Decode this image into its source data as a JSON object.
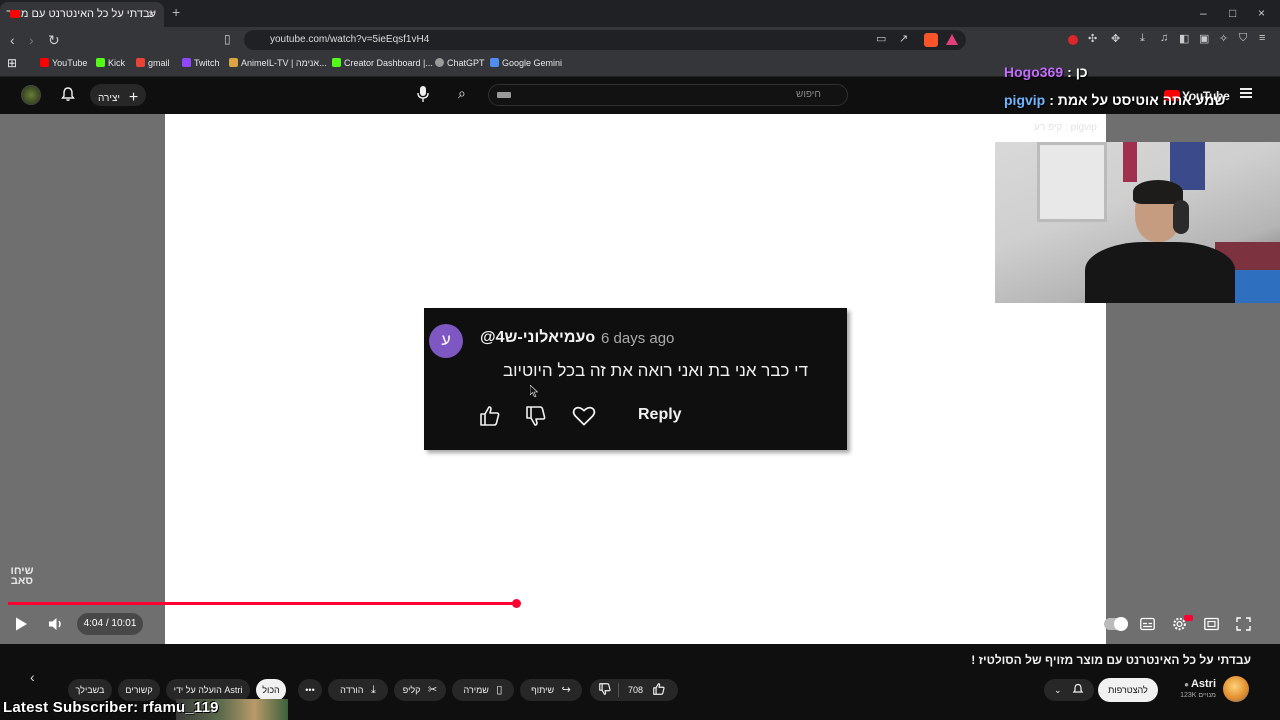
{
  "browser": {
    "tab_title": "עבדתי על כל האינטרנט עם מוצר",
    "tab_close": "×",
    "new_tab": "+",
    "url": "youtube.com/watch?v=5ieEqsf1vH4",
    "window_controls": [
      "–",
      "□",
      "×"
    ],
    "bookmarks": [
      {
        "label": "YouTube",
        "color": "#ff0000"
      },
      {
        "label": "Kick",
        "color": "#53fc18"
      },
      {
        "label": "gmail",
        "color": "#ea4335"
      },
      {
        "label": "Twitch",
        "color": "#9146ff"
      },
      {
        "label": "AnimeIL-TV | אנימה...",
        "color": "#d9a441"
      },
      {
        "label": "Creator Dashboard |...",
        "color": "#53fc18"
      },
      {
        "label": "ChatGPT",
        "color": "#9a9a9a"
      },
      {
        "label": "Google Gemini",
        "color": "#4f8df5"
      }
    ]
  },
  "youtube_header": {
    "search_placeholder": "חיפוש",
    "create_label": "יצירה",
    "logo_text": "YouTube"
  },
  "stream_overlay": {
    "chat1_user": "Hogo369",
    "chat1_msg": ": כן",
    "chat2_user": "pigvip",
    "chat2_msg": ": שמע אתה אוטיסט על אמת",
    "chat3_text": "קיפ רע : pigvip"
  },
  "comment": {
    "avatar_letter": "ע",
    "author": "@עמיאלוני-ש4o",
    "time": "6 days ago",
    "text": "די כבר אני בת ואני רואה את זה בכל היוטיוב",
    "reply_label": "Reply"
  },
  "watermark": "שיחו סאב",
  "player": {
    "time_display": "4:04 / 10:01",
    "progress_fraction": 0.463,
    "buffered_fraction": 0.502
  },
  "video_info": {
    "title": "עבדתי על כל האינטרנט עם מוצר מזויף של הסולטיז !",
    "channel_name": "Astri",
    "channel_subs": "123K מנויים",
    "subscribe_label": "להצטרפות",
    "like_count": "708",
    "share_label": "שיתוף",
    "save_label": "שמירה",
    "clip_label": "קליפ",
    "download_label": "הורדה",
    "more_label": "•••",
    "chips": [
      "הכול",
      "הועלה על ידי Astri",
      "קשורים",
      "בשבילך"
    ],
    "chip_prev": "‹"
  },
  "stream_footer": {
    "latest_subscriber": "Latest Subscriber: rfamu_119"
  },
  "colors": {
    "accent_red": "#ff0033",
    "background": "#0f0f0f",
    "comment_avatar": "#7e57c2"
  }
}
